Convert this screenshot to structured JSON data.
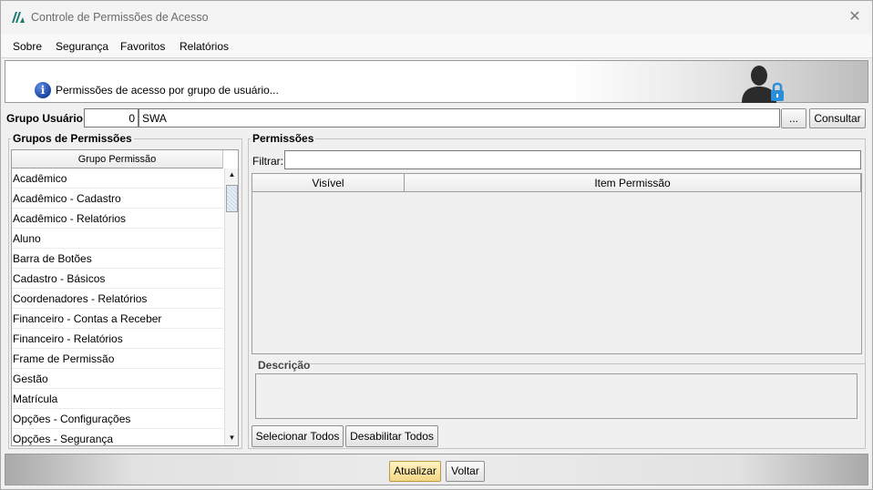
{
  "window": {
    "title": "Controle de Permissões de Acesso",
    "close_glyph": "✕",
    "app_icon": "app-logo-icon"
  },
  "menu": [
    {
      "label": "Sobre"
    },
    {
      "label": "Segurança"
    },
    {
      "label": "Favoritos"
    },
    {
      "label": "Relatórios"
    }
  ],
  "header": {
    "text": "Permissões de acesso por grupo de usuário...",
    "info_icon": "info-icon",
    "user_icon": "user-lock-icon",
    "lock_color": "#2a8fd8"
  },
  "grupo_usuario": {
    "label": "Grupo Usuário:",
    "code": "0",
    "name": "SWA",
    "ellipsis_label": "...",
    "consultar_label": "Consultar"
  },
  "grupos_permissoes": {
    "title": "Grupos de Permissões",
    "column": "Grupo Permissão",
    "items": [
      "Acadêmico",
      "Acadêmico - Cadastro",
      "Acadêmico - Relatórios",
      "Aluno",
      "Barra de Botões",
      "Cadastro - Básicos",
      "Coordenadores - Relatórios",
      "Financeiro - Contas a Receber",
      "Financeiro - Relatórios",
      "Frame de Permissão",
      "Gestão",
      "Matrícula",
      "Opções - Configurações",
      "Opções - Segurança"
    ]
  },
  "permissoes": {
    "title": "Permissões",
    "filter_label": "Filtrar:",
    "filter_value": "",
    "columns": [
      "Visível",
      "Item Permissão"
    ],
    "descricao_title": "Descrição",
    "descricao_value": "",
    "selecionar_label": "Selecionar Todos",
    "desabilitar_label": "Desabilitar Todos"
  },
  "footer": {
    "atualizar_label": "Atualizar",
    "voltar_label": "Voltar",
    "atualizar_color": "#f3d785"
  }
}
